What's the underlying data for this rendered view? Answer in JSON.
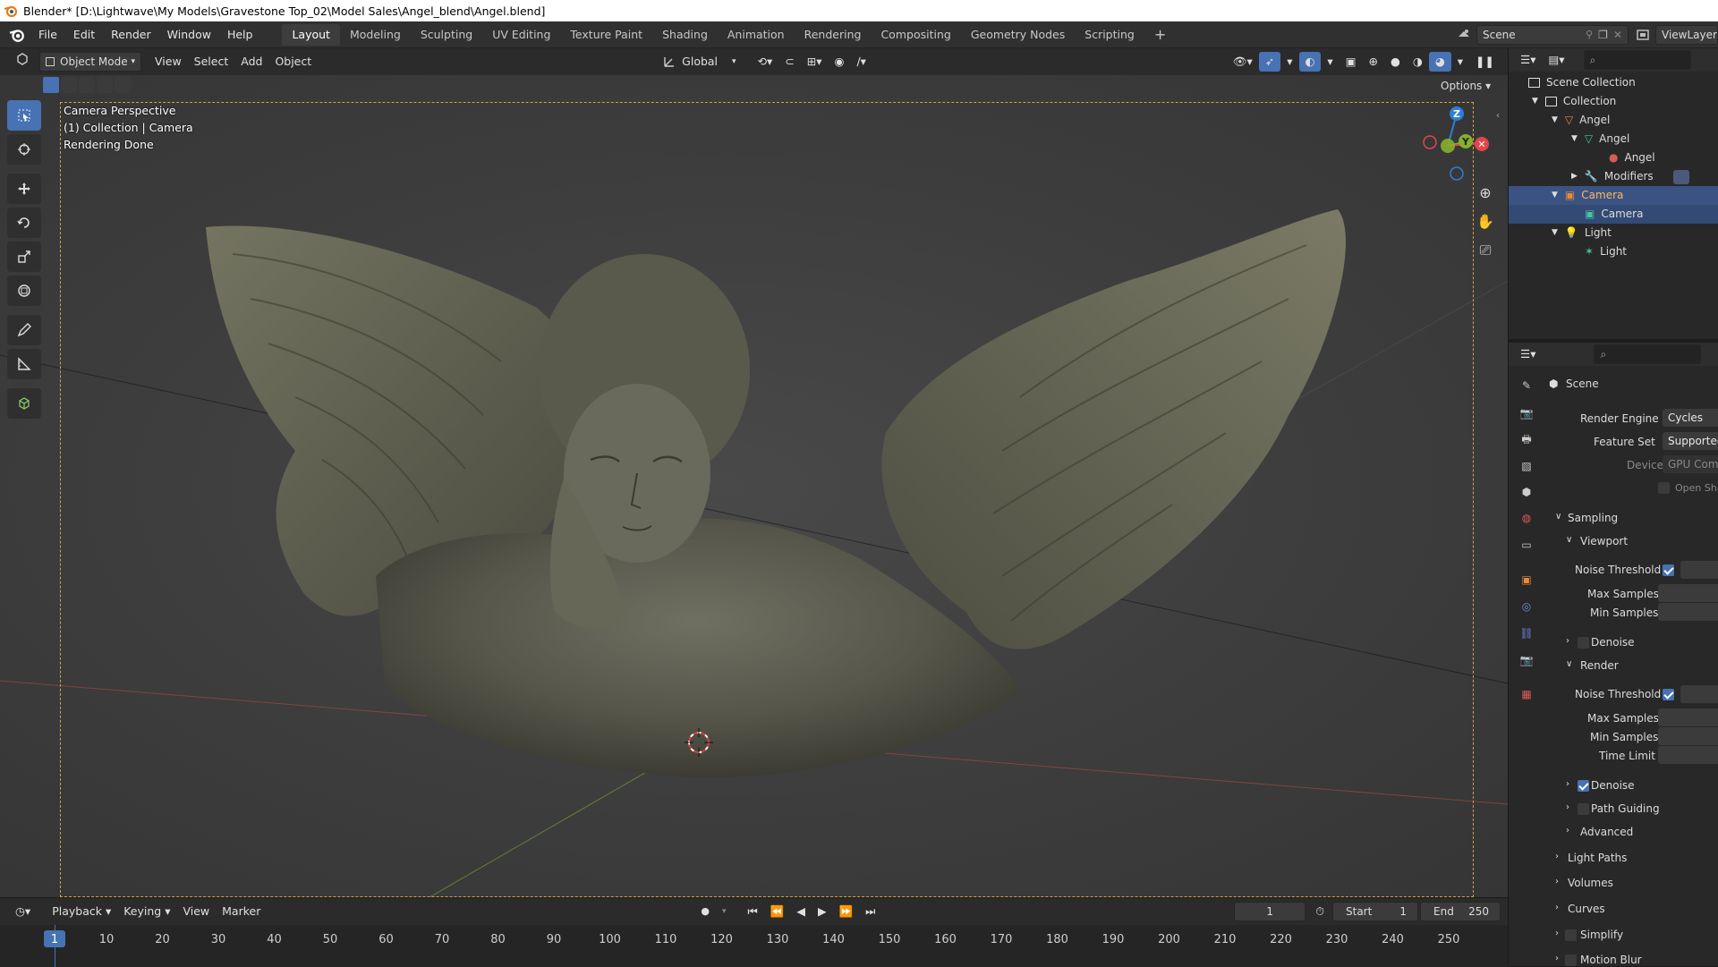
{
  "titlebar": {
    "title": "Blender* [D:\\Lightwave\\My Models\\Gravestone Top_02\\Model Sales\\Angel_blend\\Angel.blend]"
  },
  "menu": [
    "File",
    "Edit",
    "Render",
    "Window",
    "Help"
  ],
  "workspaces": [
    "Layout",
    "Modeling",
    "Sculpting",
    "UV Editing",
    "Texture Paint",
    "Shading",
    "Animation",
    "Rendering",
    "Compositing",
    "Geometry Nodes",
    "Scripting"
  ],
  "active_workspace": "Layout",
  "scene_name": "Scene",
  "viewlayer": "ViewLayer",
  "header": {
    "mode": "Object Mode",
    "menus": [
      "View",
      "Select",
      "Add",
      "Object"
    ],
    "transform_orientation": "Global",
    "options": "Options"
  },
  "overlay": {
    "line1": "Camera Perspective",
    "line2": "(1) Collection | Camera",
    "line3": "Rendering Done"
  },
  "gizmo": {
    "z": "Z",
    "y": "Y"
  },
  "outliner": {
    "items": [
      {
        "label": "Scene Collection",
        "icon": "scene-collection-icon"
      },
      {
        "label": "Collection",
        "icon": "collection-icon"
      },
      {
        "label": "Angel",
        "icon": "mesh-object-icon"
      },
      {
        "label": "Angel",
        "icon": "mesh-data-icon"
      },
      {
        "label": "Angel",
        "icon": "material-icon"
      },
      {
        "label": "Modifiers",
        "icon": "wrench-icon"
      },
      {
        "label": "Camera",
        "icon": "camera-object-icon"
      },
      {
        "label": "Camera",
        "icon": "camera-data-icon"
      },
      {
        "label": "Light",
        "icon": "light-object-icon"
      },
      {
        "label": "Light",
        "icon": "light-data-icon"
      }
    ]
  },
  "properties": {
    "context": "Scene",
    "render_engine_label": "Render Engine",
    "render_engine": "Cycles",
    "feature_set_label": "Feature Set",
    "feature_set": "Supported",
    "device_label": "Device",
    "device": "GPU Compute",
    "open_shading": "Open Shading Language",
    "sections": {
      "sampling": "Sampling",
      "viewport": "Viewport",
      "render": "Render",
      "noise_threshold": "Noise Threshold",
      "max_samples": "Max Samples",
      "min_samples": "Min Samples",
      "time_limit": "Time Limit",
      "denoise": "Denoise",
      "path_guiding": "Path Guiding",
      "advanced": "Advanced",
      "light_paths": "Light Paths",
      "volumes": "Volumes",
      "curves": "Curves",
      "simplify": "Simplify",
      "motion_blur": "Motion Blur"
    }
  },
  "timeline": {
    "menus": [
      "Playback",
      "Keying",
      "View",
      "Marker"
    ],
    "current_frame": "1",
    "start_label": "Start",
    "start": "1",
    "end_label": "End",
    "end": "250",
    "ticks": [
      "1",
      "10",
      "20",
      "30",
      "40",
      "50",
      "60",
      "70",
      "80",
      "90",
      "100",
      "110",
      "120",
      "130",
      "140",
      "150",
      "160",
      "170",
      "180",
      "190",
      "200",
      "210",
      "220",
      "230",
      "240",
      "250"
    ]
  },
  "colors": {
    "accent": "#4772b3",
    "camera_frame": "#d7a13f",
    "x_axis": "#e2464b",
    "y_axis": "#86b02e",
    "z_axis": "#2e7ed8"
  }
}
